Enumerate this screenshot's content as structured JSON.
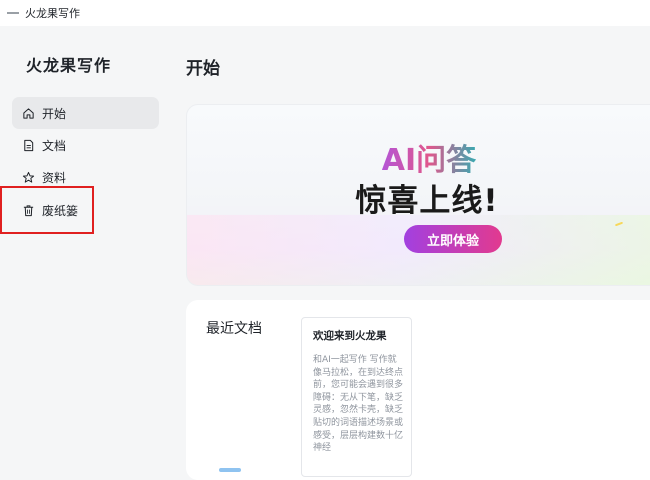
{
  "window": {
    "title": "火龙果写作",
    "icon": "app-icon"
  },
  "sidebar": {
    "brand": "火龙果写作",
    "items": [
      {
        "label": "开始",
        "icon": "home-icon",
        "active": true
      },
      {
        "label": "文档",
        "icon": "document-icon",
        "active": false
      },
      {
        "label": "资料",
        "icon": "star-icon",
        "active": false
      },
      {
        "label": "废纸篓",
        "icon": "trash-icon",
        "active": false
      }
    ],
    "highlight_color": "#e02020"
  },
  "main": {
    "title": "开始",
    "banner": {
      "heading": "AI问答",
      "subheading": "惊喜上线!",
      "button": "立即体验",
      "button_gradient": [
        "#a240e0",
        "#e23a8f"
      ]
    },
    "recent": {
      "title": "最近文档",
      "documents": [
        {
          "title": "欢迎来到火龙果",
          "preview": "和AI一起写作 写作就像马拉松，在到达终点前，您可能会遇到很多障碍：无从下笔，缺乏灵感，忽然卡壳，缺乏贴切的词语描述场景或感受，层层构建数十亿神经"
        }
      ]
    }
  }
}
